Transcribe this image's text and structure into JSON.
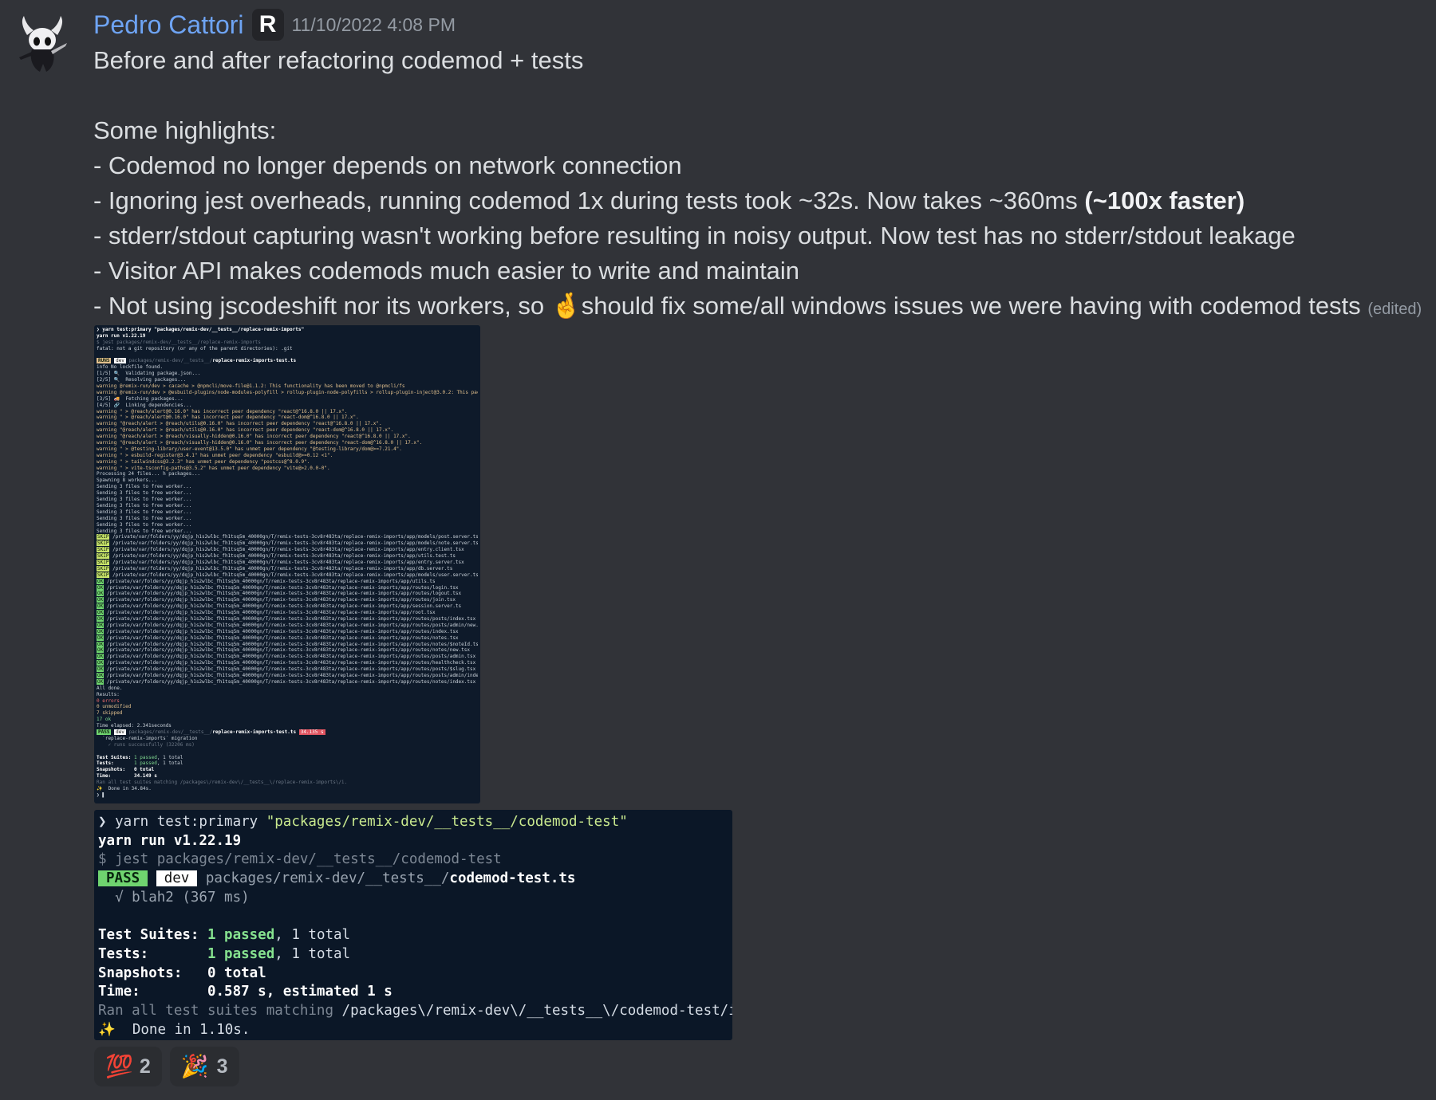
{
  "message": {
    "author": "Pedro Cattori",
    "role_icon_letter": "R",
    "timestamp": "11/10/2022 4:08 PM",
    "lines": [
      "Before and after refactoring codemod + tests",
      "Some highlights:",
      "- Codemod no longer depends on network connection",
      "- Ignoring jest overheads, running codemod 1x during tests took ~32s. Now takes ~360ms ",
      "(~100x faster)",
      "- stderr/stdout capturing wasn't working before resulting in noisy output. Now test has no stderr/stdout leakage",
      "- Visitor API makes codemods much easier to write and maintain",
      "- Not using jscodeshift nor its workers, so ",
      "🤞",
      "should fix some/all windows issues we were having with codemod tests",
      "(edited)"
    ]
  },
  "terminal_small": {
    "cmd": "❯ yarn test:primary \"packages/remix-dev/__tests__/replace-remix-imports\"",
    "yarn": "yarn run v1.22.19",
    "jest": "$ jest packages/remix-dev/__tests__/replace-remix-imports",
    "fatal": "fatal: not a git repository (or any of the parent directories): .git",
    "runs_label": "RUNS",
    "dev_label": "dev",
    "runs_path": "packages/remix-dev/__tests__/",
    "runs_file": "replace-remix-imports-test.ts",
    "info_lines": [
      "info No lockfile found.",
      "[1/5] 🔍  Validating package.json...",
      "[2/5] 🔍  Resolving packages...",
      "warning @remix-run/dev > cacache > @npmcli/move-file@1.1.2: This functionality has been moved to @npmcli/fs",
      "warning @remix-run/dev > @esbuild-plugins/node-modules-polyfill > rollup-plugin-node-polyfills > rollup-plugin-inject@3.0.2: This package has",
      "[3/5] 🚚  Fetching packages...",
      "[4/5] 🔗  Linking dependencies...",
      "warning \" > @reach/alert@0.16.0\" has incorrect peer dependency \"react@^16.8.0 || 17.x\".",
      "warning \" > @reach/alert@0.16.0\" has incorrect peer dependency \"react-dom@^16.8.0 || 17.x\".",
      "warning \"@reach/alert > @reach/utils@0.16.0\" has incorrect peer dependency \"react@^16.8.0 || 17.x\".",
      "warning \"@reach/alert > @reach/utils@0.16.0\" has incorrect peer dependency \"react-dom@^16.8.0 || 17.x\".",
      "warning \"@reach/alert > @reach/visually-hidden@0.16.0\" has incorrect peer dependency \"react@^16.8.0 || 17.x\".",
      "warning \"@reach/alert > @reach/visually-hidden@0.16.0\" has incorrect peer dependency \"react-dom@^16.8.0 || 17.x\".",
      "warning \" > @testing-library/user-event@13.5.0\" has unmet peer dependency \"@testing-library/dom@>=7.21.4\".",
      "warning \" > esbuild-register@3.4.1\" has unmet peer dependency \"esbuild@>=0.12 <1\".",
      "warning \" > tailwindcss@3.2.3\" has unmet peer dependency \"postcss@^8.0.9\".",
      "warning \" > vite-tsconfig-paths@3.5.2\" has unmet peer dependency \"vite@>2.0.0-0\".",
      "Processing 24 files... h packages...",
      "Spawning 8 workers...",
      "Sending 3 files to free worker...",
      "Sending 3 files to free worker...",
      "Sending 3 files to free worker...",
      "Sending 3 files to free worker...",
      "Sending 3 files to free worker...",
      "Sending 3 files to free worker...",
      "Sending 3 files to free worker...",
      "Sending 3 files to free worker..."
    ],
    "path_prefix": "/private/var/folders/yy/dqjp_h1s2wlbc_fh1tsq5m_40000gn/T/remix-tests-3cv8r483ta/replace-remix-imports/app/",
    "skip_files": [
      "models/post.server.ts",
      "models/note.server.ts",
      "entry.client.tsx",
      "utils.test.ts",
      "entry.server.tsx",
      "db.server.ts",
      "models/user.server.ts"
    ],
    "ok_files": [
      "utils.ts",
      "routes/login.tsx",
      "routes/logout.tsx",
      "routes/join.tsx",
      "session.server.ts",
      "root.tsx",
      "routes/posts/index.tsx",
      "routes/posts/admin/new.tsx",
      "routes/index.tsx",
      "routes/notes.tsx",
      "routes/notes/$noteId.tsx",
      "routes/notes/new.tsx",
      "routes/posts/admin.tsx",
      "routes/healthcheck.tsx",
      "routes/posts/$slug.tsx",
      "routes/posts/admin/index.tsx",
      "routes/notes/index.tsx"
    ],
    "skip_label": "SKIP",
    "ok_label": "OK",
    "all_done": "All done.",
    "results": "Results:",
    "errors": "0 errors",
    "unmodified": "0 unmodified",
    "skipped": "7 skipped",
    "ok": "17 ok",
    "elapsed": "Time elapsed: 2.341seconds",
    "pass_label": "PASS",
    "pass_path": "packages/remix-dev/__tests__/",
    "pass_file": "replace-remix-imports-test.ts",
    "pass_time": "34.135 s",
    "migration": "  `replace-remix-imports` migration",
    "runs_ok": "    ✓ runs successfully (32206 ms)",
    "suites_label": "Test Suites:",
    "suites_passed": "1 passed",
    "suites_total": ", 1 total",
    "tests_label": "Tests:       ",
    "tests_passed": "1 passed",
    "tests_total": ", 1 total",
    "snap": "Snapshots:   0 total",
    "time": "Time:        34.149 s",
    "ran_all": "Ran all test suites matching /packages\\/remix-dev\\/__tests__\\/replace-remix-imports\\/i.",
    "done": "✨  Done in 34.84s.",
    "prompt": "❯ ▌"
  },
  "terminal_big": {
    "cmd_prefix": "❯ yarn test:primary ",
    "cmd_arg": "\"packages/remix-dev/__tests__/codemod-test\"",
    "yarn": "yarn run v1.22.19",
    "jest": "$ jest packages/remix-dev/__tests__/codemod-test",
    "pass_label": "PASS",
    "dev_label": "dev",
    "path": "packages/remix-dev/__tests__/",
    "file": "codemod-test.ts",
    "check": "  √ blah2 (367 ms)",
    "suites_label": "Test Suites: ",
    "suites_passed": "1 passed",
    "suites_total": ", 1 total",
    "tests_label": "Tests:       ",
    "tests_passed": "1 passed",
    "tests_total": ", 1 total",
    "snap": "Snapshots:   0 total",
    "time": "Time:        0.587 s, estimated 1 s",
    "ran_prefix": "Ran all test suites matching ",
    "ran_path": "/packages\\/remix-dev\\/__tests__\\/codemod-test/i.",
    "done": "✨  Done in 1.10s."
  },
  "reactions": [
    {
      "emoji": "💯",
      "count": "2"
    },
    {
      "emoji": "🎉",
      "count": "3"
    }
  ],
  "colors": {
    "background": "#313338",
    "username": "#6ea4f4",
    "timestamp": "#949ba4",
    "reaction_bg": "#2b2d31",
    "terminal_bg": "#0b1727",
    "pass_green": "#6fd46f"
  }
}
